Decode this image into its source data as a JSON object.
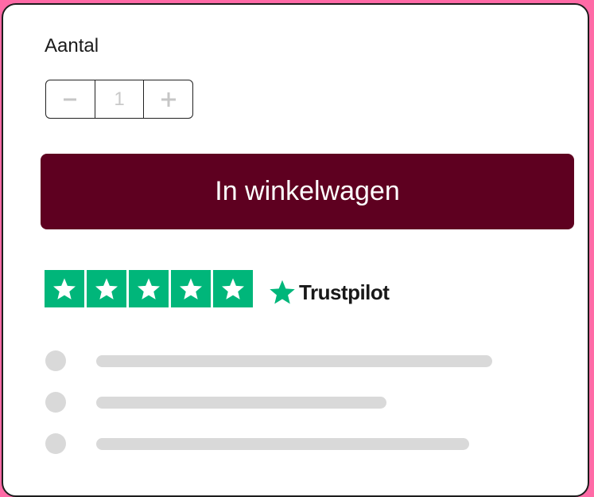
{
  "quantity": {
    "label": "Aantal",
    "value": "1",
    "decrement_symbol": "−",
    "increment_symbol": "+"
  },
  "cart_button": {
    "label": "In winkelwagen"
  },
  "trustpilot": {
    "brand": "Trustpilot",
    "rating_stars": 5,
    "star_color": "#00b67a",
    "star_icon": "star-icon"
  },
  "colors": {
    "page_background": "#ff6aa6",
    "button_background": "#5e0020",
    "placeholder": "#d9d9d9"
  }
}
